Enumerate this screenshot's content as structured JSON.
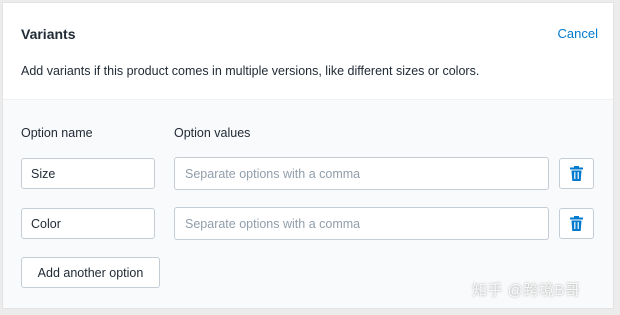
{
  "header": {
    "title": "Variants",
    "cancel_label": "Cancel",
    "description": "Add variants if this product comes in multiple versions, like different sizes or colors."
  },
  "columns": {
    "option_name": "Option name",
    "option_values": "Option values"
  },
  "options": [
    {
      "name": "Size",
      "values_placeholder": "Separate options with a comma",
      "delete_icon": "trash-icon"
    },
    {
      "name": "Color",
      "values_placeholder": "Separate options with a comma",
      "delete_icon": "trash-icon"
    }
  ],
  "add_option_label": "Add another option",
  "watermark": "知乎 @跨境B哥",
  "colors": {
    "accent": "#007ace",
    "text": "#212b36",
    "placeholder": "#919eab",
    "border": "#c4cdd5",
    "section_bg": "#f9fafb"
  }
}
